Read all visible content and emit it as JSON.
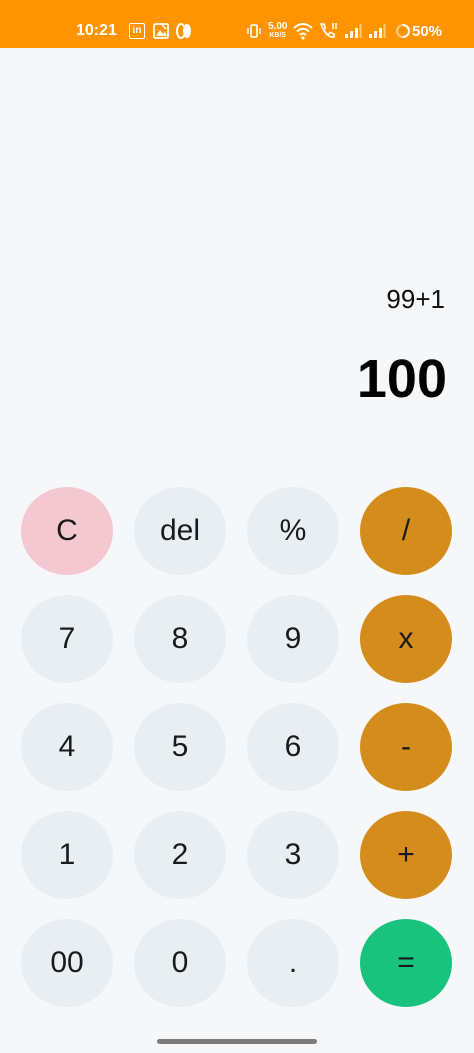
{
  "status_bar": {
    "time": "10:21",
    "linkedin_glyph": "in",
    "speed_value": "5.00",
    "speed_unit": "KB/S",
    "battery_percent": "50%",
    "icons": [
      "linkedin-icon",
      "gallery-icon",
      "pill-icon",
      "vibrate-icon",
      "wifi-icon",
      "call-icon",
      "signal-icon",
      "battery-icon"
    ],
    "background_color": "#ff9400"
  },
  "display": {
    "expression": "99+1",
    "result": "100"
  },
  "keypad": {
    "clear": "C",
    "delete": "del",
    "percent": "%",
    "divide": "/",
    "seven": "7",
    "eight": "8",
    "nine": "9",
    "multiply": "x",
    "four": "4",
    "five": "5",
    "six": "6",
    "subtract": "-",
    "one": "1",
    "two": "2",
    "three": "3",
    "add": "+",
    "double_zero": "00",
    "zero": "0",
    "decimal": ".",
    "equals": "="
  },
  "colors": {
    "number_button": "#e9eef2",
    "clear_button": "#f4c8d1",
    "operator_button": "#d48d1c",
    "equals_button": "#19c37d"
  }
}
